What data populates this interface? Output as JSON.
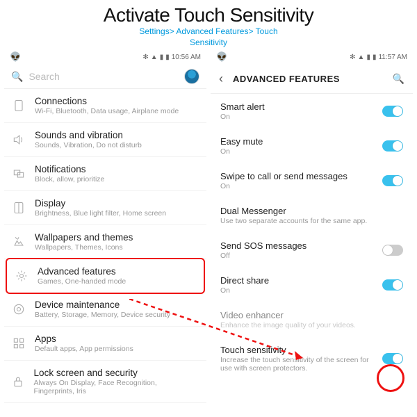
{
  "header": {
    "title": "Activate Touch Sensitivity",
    "breadcrumb_line1": "Settings> Advanced Features> Touch",
    "breadcrumb_line2": "Sensitivity"
  },
  "left": {
    "status_time": "10:56 AM",
    "search_placeholder": "Search",
    "items": [
      {
        "label": "Connections",
        "sub": "Wi-Fi, Bluetooth, Data usage, Airplane mode"
      },
      {
        "label": "Sounds and vibration",
        "sub": "Sounds, Vibration, Do not disturb"
      },
      {
        "label": "Notifications",
        "sub": "Block, allow, prioritize"
      },
      {
        "label": "Display",
        "sub": "Brightness, Blue light filter, Home screen"
      },
      {
        "label": "Wallpapers and themes",
        "sub": "Wallpapers, Themes, Icons"
      },
      {
        "label": "Advanced features",
        "sub": "Games, One-handed mode"
      },
      {
        "label": "Device maintenance",
        "sub": "Battery, Storage, Memory, Device security"
      },
      {
        "label": "Apps",
        "sub": "Default apps, App permissions"
      },
      {
        "label": "Lock screen and security",
        "sub": "Always On Display, Face Recognition, Fingerprints, Iris"
      }
    ]
  },
  "right": {
    "status_time": "11:57 AM",
    "page_title": "ADVANCED FEATURES",
    "items": [
      {
        "label": "Smart alert",
        "sub": "On",
        "toggle": "on"
      },
      {
        "label": "Easy mute",
        "sub": "On",
        "toggle": "on"
      },
      {
        "label": "Swipe to call or send messages",
        "sub": "On",
        "toggle": "on"
      },
      {
        "label": "Dual Messenger",
        "sub": "Use two separate accounts for the same app.",
        "toggle": null
      },
      {
        "label": "Send SOS messages",
        "sub": "Off",
        "toggle": "off"
      },
      {
        "label": "Direct share",
        "sub": "On",
        "toggle": "on"
      },
      {
        "label": "Video enhancer",
        "sub": "Enhance the image quality of your videos.",
        "toggle": null,
        "gray": true
      },
      {
        "label": "Touch sensitivity",
        "sub": "Increase the touch sensitivity of the screen for use with screen protectors.",
        "toggle": "on"
      }
    ]
  }
}
